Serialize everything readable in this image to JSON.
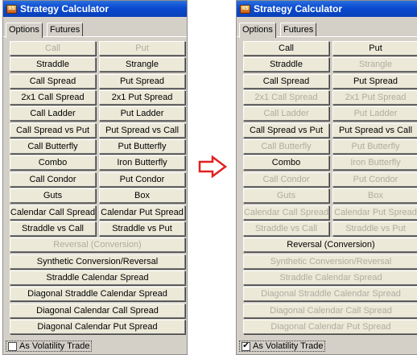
{
  "left": {
    "title": "Strategy Calculator",
    "app_icon_text": "XS",
    "tabs": [
      "Options",
      "Futures"
    ],
    "buttons": [
      [
        "Call",
        "Put"
      ],
      [
        "Straddle",
        "Strangle"
      ],
      [
        "Call Spread",
        "Put Spread"
      ],
      [
        "2x1 Call Spread",
        "2x1 Put Spread"
      ],
      [
        "Call Ladder",
        "Put Ladder"
      ],
      [
        "Call Spread vs Put",
        "Put Spread vs Call"
      ],
      [
        "Call Butterfly",
        "Put Butterfly"
      ],
      [
        "Combo",
        "Iron Butterfly"
      ],
      [
        "Call Condor",
        "Put Condor"
      ],
      [
        "Guts",
        "Box"
      ],
      [
        "Calendar Call Spread",
        "Calendar Put Spread"
      ],
      [
        "Straddle vs Call",
        "Straddle vs Put"
      ]
    ],
    "full_buttons": [
      "Reversal (Conversion)",
      "Synthetic Conversion/Reversal",
      "Straddle Calendar Spread",
      "Diagonal Straddle Calendar Spread",
      "Diagonal Calendar Call Spread",
      "Diagonal Calendar Put Spread"
    ],
    "checkbox_label": "As Volatility Trade",
    "checkbox_checked": false
  },
  "right": {
    "title": "Strategy Calculator",
    "app_icon_text": "XS",
    "tabs": [
      "Options",
      "Futures"
    ],
    "buttons": [
      [
        "Call",
        "Put"
      ],
      [
        "Straddle",
        "Strangle"
      ],
      [
        "Call Spread",
        "Put Spread"
      ],
      [
        "2x1 Call Spread",
        "2x1 Put Spread"
      ],
      [
        "Call Ladder",
        "Put Ladder"
      ],
      [
        "Call Spread vs Put",
        "Put Spread vs Call"
      ],
      [
        "Call Butterfly",
        "Put Butterfly"
      ],
      [
        "Combo",
        "Iron Butterfly"
      ],
      [
        "Call Condor",
        "Put Condor"
      ],
      [
        "Guts",
        "Box"
      ],
      [
        "Calendar Call Spread",
        "Calendar Put Spread"
      ],
      [
        "Straddle vs Call",
        "Straddle vs Put"
      ]
    ],
    "full_buttons": [
      "Reversal (Conversion)",
      "Synthetic Conversion/Reversal",
      "Straddle Calendar Spread",
      "Diagonal Straddle Calendar Spread",
      "Diagonal Calendar Call Spread",
      "Diagonal Calendar Put Spread"
    ],
    "checkbox_label": "As Volatility Trade",
    "checkbox_checked": true
  },
  "disabled": {
    "left": [
      "Call",
      "Put",
      "Reversal (Conversion)"
    ],
    "right": [
      "Strangle",
      "2x1 Call Spread",
      "2x1 Put Spread",
      "Call Ladder",
      "Put Ladder",
      "Call Butterfly",
      "Put Butterfly",
      "Iron Butterfly",
      "Call Condor",
      "Put Condor",
      "Guts",
      "Box",
      "Calendar Call Spread",
      "Calendar Put Spread",
      "Straddle vs Call",
      "Straddle vs Put",
      "Synthetic Conversion/Reversal",
      "Straddle Calendar Spread",
      "Diagonal Straddle Calendar Spread",
      "Diagonal Calendar Call Spread",
      "Diagonal Calendar Put Spread"
    ]
  },
  "colors": {
    "title_bar": "#0a4ad1",
    "panel_bg": "#d4d0c8",
    "button_bg": "#ece9d8",
    "disabled_text": "#b0aca0",
    "arrow": "#e02020"
  },
  "arrow_icon": "right-arrow-icon"
}
